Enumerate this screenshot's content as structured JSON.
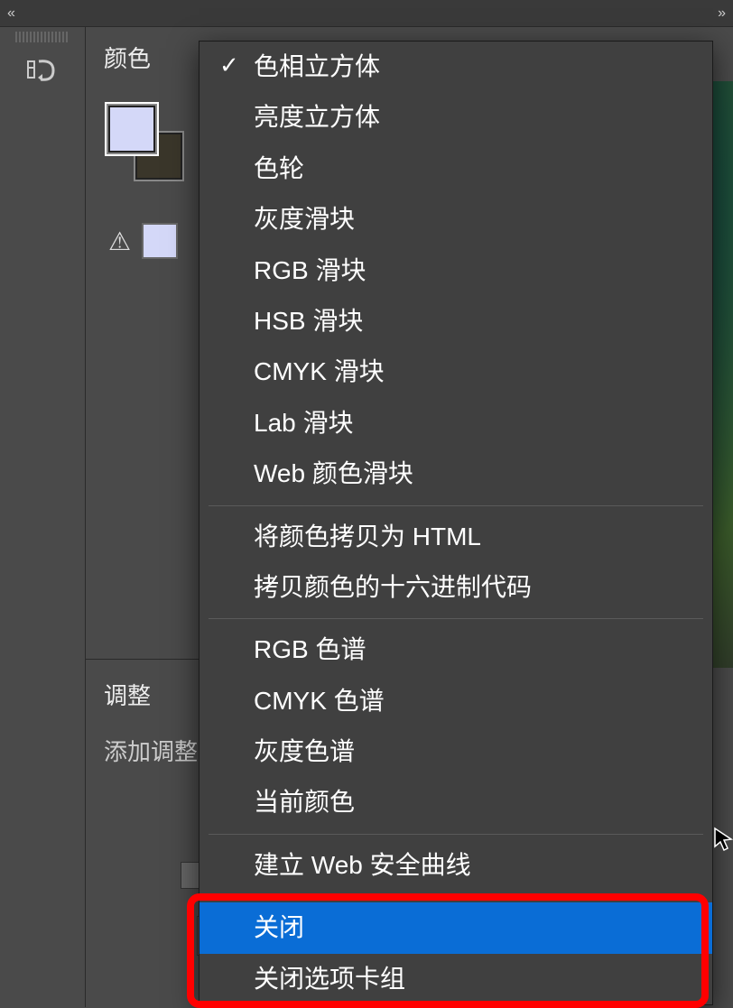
{
  "topbar": {
    "collapse_left": "«",
    "expand_right": "»"
  },
  "panels": {
    "color": {
      "tab_label": "颜色"
    },
    "adjustments": {
      "tab_label": "调整",
      "subtitle": "添加调整"
    }
  },
  "context_menu": {
    "groups": [
      [
        {
          "label": "色相立方体",
          "checked": true
        },
        {
          "label": "亮度立方体",
          "checked": false
        },
        {
          "label": "色轮",
          "checked": false
        },
        {
          "label": "灰度滑块",
          "checked": false
        },
        {
          "label": "RGB 滑块",
          "checked": false
        },
        {
          "label": "HSB 滑块",
          "checked": false
        },
        {
          "label": "CMYK 滑块",
          "checked": false
        },
        {
          "label": "Lab 滑块",
          "checked": false
        },
        {
          "label": "Web 颜色滑块",
          "checked": false
        }
      ],
      [
        {
          "label": "将颜色拷贝为 HTML",
          "checked": false
        },
        {
          "label": "拷贝颜色的十六进制代码",
          "checked": false
        }
      ],
      [
        {
          "label": "RGB 色谱",
          "checked": false
        },
        {
          "label": "CMYK 色谱",
          "checked": false
        },
        {
          "label": "灰度色谱",
          "checked": false
        },
        {
          "label": "当前颜色",
          "checked": false
        }
      ],
      [
        {
          "label": "建立 Web 安全曲线",
          "checked": false
        }
      ],
      [
        {
          "label": "关闭",
          "checked": false,
          "highlighted": true
        },
        {
          "label": "关闭选项卡组",
          "checked": false
        }
      ]
    ]
  },
  "colors": {
    "foreground": "#d4d8f8",
    "background": "#3a362a"
  }
}
